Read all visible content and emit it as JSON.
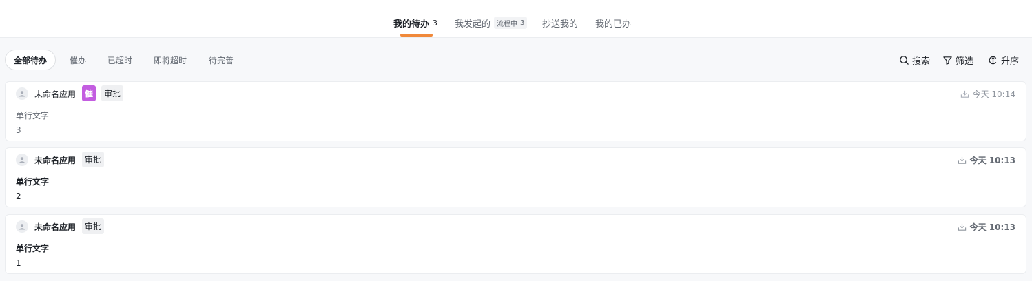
{
  "tabs": [
    {
      "label": "我的待办",
      "count": "3"
    },
    {
      "label": "我发起的",
      "badge_label": "流程中",
      "badge_count": "3"
    },
    {
      "label": "抄送我的"
    },
    {
      "label": "我的已办"
    }
  ],
  "colors": {
    "accent": "#f0893a",
    "urge": "#c35de0"
  },
  "filters": [
    "全部待办",
    "催办",
    "已超时",
    "即将超时",
    "待完善"
  ],
  "tools": {
    "search": "搜索",
    "filter": "筛选",
    "sort": "升序"
  },
  "icons": {
    "search": "search-icon",
    "filter": "funnel-icon",
    "sort": "sort-icon",
    "avatar": "user-icon",
    "time": "inbox-download-icon"
  },
  "cards": [
    {
      "app": "未命名应用",
      "urge": "催",
      "type": "审批",
      "time": "今天 10:14",
      "field_label": "单行文字",
      "field_value": "3"
    },
    {
      "app": "未命名应用",
      "type": "审批",
      "time": "今天 10:13",
      "field_label": "单行文字",
      "field_value": "2"
    },
    {
      "app": "未命名应用",
      "type": "审批",
      "time": "今天 10:13",
      "field_label": "单行文字",
      "field_value": "1"
    }
  ]
}
